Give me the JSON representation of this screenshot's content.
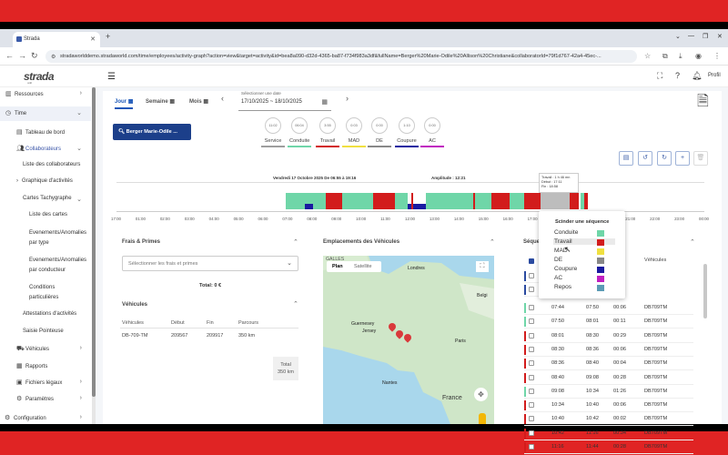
{
  "browser": {
    "tab_title": "Strada",
    "url": "stradaworlddemo.stradaworld.com/time/employees/activity-graph?action=view&target=activity&id=bea8a090-d32d-4365-ba87-f734f983a3df&fullName=Berger%20Marie-Odile%20Allison%20Christiane&collaboratorId=79f1d767-42a4-45ec-..."
  },
  "header": {
    "logo": "strada",
    "logo_sub": "world",
    "profile_label": "Profil"
  },
  "sidebar": {
    "items": [
      {
        "label": "Ressources",
        "icon": "book-icon"
      },
      {
        "label": "Time",
        "icon": "clock-icon"
      },
      {
        "label": "Tableau de bord",
        "icon": "dashboard-icon"
      },
      {
        "label": "Collaborateurs",
        "icon": "people-icon"
      },
      {
        "label": "Liste des collaborateurs"
      },
      {
        "label": "Graphique d'activités"
      },
      {
        "label": "Cartes Tachygraphe"
      },
      {
        "label": "Liste des cartes"
      },
      {
        "label": "Evenements/Anomalies par type"
      },
      {
        "label": "Evenements/Anomalies par conducteur"
      },
      {
        "label": "Conditions particulières"
      },
      {
        "label": "Attestations d'activités"
      },
      {
        "label": "Saisie Pointeuse"
      },
      {
        "label": "Véhicules",
        "icon": "truck-icon"
      },
      {
        "label": "Rapports",
        "icon": "report-icon"
      },
      {
        "label": "Fichiers légaux",
        "icon": "files-icon"
      },
      {
        "label": "Paramètres",
        "icon": "gear-icon"
      },
      {
        "label": "Configuration",
        "icon": "settings-icon"
      }
    ]
  },
  "period": {
    "tabs": [
      "Jour",
      "Semaine",
      "Mois"
    ],
    "active": "Jour",
    "date_label": "Sélectionner une date",
    "date_value": "17/10/2025 ~ 18/10/2025"
  },
  "driver": {
    "name": "Berger Marie-Odile ..."
  },
  "gauges": [
    {
      "value": "11:02",
      "label": "Service",
      "color": "#9e9e9e"
    },
    {
      "value": "06:04",
      "label": "Conduite",
      "color": "#6fd6a8"
    },
    {
      "value": "3:55",
      "label": "Travail",
      "color": "#d21c1c"
    },
    {
      "value": "0:03",
      "label": "MAD",
      "color": "#f0e040"
    },
    {
      "value": "0:00",
      "label": "DE",
      "color": "#888888"
    },
    {
      "value": "1:10",
      "label": "Coupure",
      "color": "#1a1aa0"
    },
    {
      "value": "0:00",
      "label": "AC",
      "color": "#c020c0"
    }
  ],
  "timeline": {
    "title": "Vendredi 17 Octobre 2025 De 06:55 à 19:16",
    "amplitude": "Amplitude : 12:21",
    "ticks": [
      "17:00",
      "01:00",
      "02:00",
      "03:00",
      "04:00",
      "05:00",
      "06:00",
      "07:00",
      "08:00",
      "09:00",
      "10:00",
      "11:00",
      "12:00",
      "13:00",
      "14:00",
      "15:00",
      "16:00",
      "17:00",
      "18:00",
      "19:00",
      "20:00",
      "21:00",
      "22:00",
      "23:00",
      "00:00"
    ],
    "tooltip": [
      "Travail : 1 h 46 mn",
      "Début : 17:11",
      "Fin : 18:58"
    ]
  },
  "frais": {
    "title": "Frais & Primes",
    "select_placeholder": "Sélectionner les frais et primes",
    "total": "Total: 0 €"
  },
  "vehicules": {
    "title": "Véhicules",
    "columns": [
      "Véhicules",
      "Début",
      "Fin",
      "Parcours"
    ],
    "rows": [
      [
        "DB-709-TM",
        "209567",
        "209917",
        "350 km"
      ]
    ],
    "total_label": "Total",
    "total_value": "350 km"
  },
  "map": {
    "title": "Emplacements des Véhicules",
    "tab_plan": "Plan",
    "tab_sat": "Satellite",
    "places": [
      "GALLES",
      "Londres",
      "Belgi",
      "Guernesey",
      "Jersey",
      "Paris",
      "Nantes",
      "France"
    ]
  },
  "sequences": {
    "title": "Séque",
    "columns": [
      "Véhicules"
    ],
    "rows": [
      {
        "start": "07:44",
        "end": "07:50",
        "dur": "00:06",
        "veh": "DB709TM",
        "color": "#6fd6a8"
      },
      {
        "start": "07:50",
        "end": "08:01",
        "dur": "00:11",
        "veh": "DB709TM",
        "color": "#6fd6a8"
      },
      {
        "start": "08:01",
        "end": "08:30",
        "dur": "00:29",
        "veh": "DB709TM",
        "color": "#d21c1c"
      },
      {
        "start": "08:30",
        "end": "08:36",
        "dur": "00:06",
        "veh": "DB709TM",
        "color": "#d21c1c"
      },
      {
        "start": "08:36",
        "end": "08:40",
        "dur": "00:04",
        "veh": "DB709TM",
        "color": "#d21c1c"
      },
      {
        "start": "08:40",
        "end": "09:08",
        "dur": "00:28",
        "veh": "DB709TM",
        "color": "#d21c1c"
      },
      {
        "start": "09:08",
        "end": "10:34",
        "dur": "01:26",
        "veh": "DB709TM",
        "color": "#6fd6a8"
      },
      {
        "start": "10:34",
        "end": "10:40",
        "dur": "00:06",
        "veh": "DB709TM",
        "color": "#d21c1c"
      },
      {
        "start": "10:40",
        "end": "10:42",
        "dur": "00:02",
        "veh": "DB709TM",
        "color": "#d21c1c"
      },
      {
        "start": "10:42",
        "end": "11:16",
        "dur": "00:34",
        "veh": "DB709TM",
        "color": "#d21c1c"
      },
      {
        "start": "11:16",
        "end": "11:44",
        "dur": "00:28",
        "veh": "DB709TM",
        "color": "#d21c1c"
      }
    ]
  },
  "popup": {
    "title": "Scinder une séquence",
    "items": [
      {
        "label": "Conduite",
        "color": "#6fd6a8"
      },
      {
        "label": "Travail",
        "color": "#d21c1c"
      },
      {
        "label": "MAD",
        "color": "#f0e040"
      },
      {
        "label": "DE",
        "color": "#888888"
      },
      {
        "label": "Coupure",
        "color": "#1a1aa0"
      },
      {
        "label": "AC",
        "color": "#c020c0"
      },
      {
        "label": "Repos",
        "color": "#5b9bb5"
      }
    ]
  }
}
